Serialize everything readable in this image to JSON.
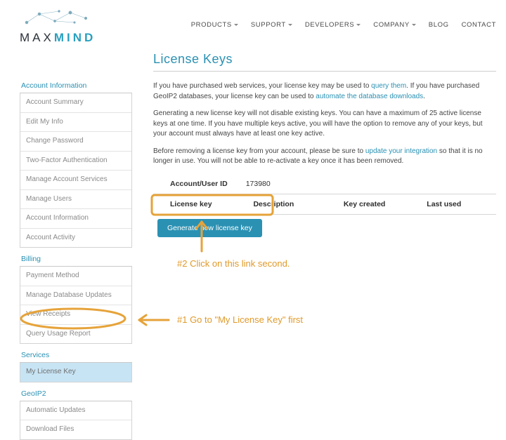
{
  "logo": {
    "text_a": "MAX",
    "text_b": "MIND"
  },
  "nav": {
    "products": "PRODUCTS",
    "support": "SUPPORT",
    "developers": "DEVELOPERS",
    "company": "COMPANY",
    "blog": "BLOG",
    "contact": "CONTACT"
  },
  "page": {
    "title": "License Keys",
    "p1a": "If you have purchased web services, your license key may be used to ",
    "p1_link1": "query them",
    "p1b": ". If you have purchased GeoIP2 databases, your license key can be used to ",
    "p1_link2": "automate the database downloads",
    "p1c": ".",
    "p2": "Generating a new license key will not disable existing keys. You can have a maximum of 25 active license keys at one time. If you have multiple keys active, you will have the option to remove any of your keys, but your account must always have at least one key active.",
    "p3a": "Before removing a license key from your account, please be sure to ",
    "p3_link": "update your integration",
    "p3b": " so that it is no longer in use. You will not be able to re-activate a key once it has been removed.",
    "account_label": "Account/User ID",
    "account_id": "173980",
    "col_key": "License key",
    "col_desc": "Description",
    "col_created": "Key created",
    "col_last": "Last used",
    "gen_btn": "Generate new license key"
  },
  "sidebar": {
    "g1_title": "Account Information",
    "g1": [
      "Account Summary",
      "Edit My Info",
      "Change Password",
      "Two-Factor Authentication",
      "Manage Account Services",
      "Manage Users",
      "Account Information",
      "Account Activity"
    ],
    "g2_title": "Billing",
    "g2": [
      "Payment Method",
      "Manage Database Updates",
      "View Receipts",
      "Query Usage Report"
    ],
    "g3_title": "Services",
    "g3": [
      "My License Key"
    ],
    "g4_title": "GeoIP2",
    "g4": [
      "Automatic Updates",
      "Download Files"
    ]
  },
  "annotations": {
    "step1": "#1 Go to \"My License Key\" first",
    "step2": "#2 Click on this link second."
  }
}
